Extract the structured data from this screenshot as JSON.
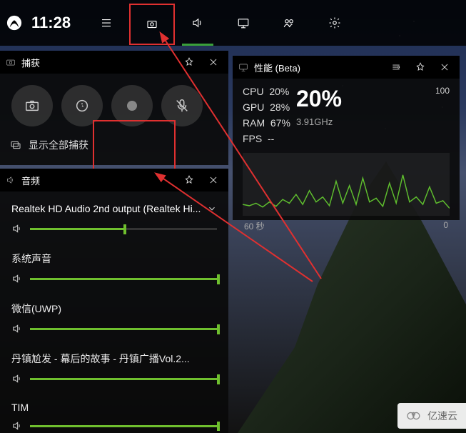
{
  "topbar": {
    "time": "11:28"
  },
  "capture": {
    "title": "捕获",
    "show_all": "显示全部捕获"
  },
  "audio": {
    "title": "音频",
    "device": "Realtek HD Audio 2nd output (Realtek Hi...",
    "device_vol": 50,
    "sections": [
      {
        "name": "系统声音",
        "vol": 100
      },
      {
        "name": "微信(UWP)",
        "vol": 100
      },
      {
        "name": "丹镇尬发 - 幕后的故事 - 丹镇广播Vol.2...",
        "vol": 100
      },
      {
        "name": "TIM",
        "vol": 100
      }
    ]
  },
  "perf": {
    "title": "性能 (Beta)",
    "metrics": {
      "cpu_label": "CPU",
      "cpu": "20%",
      "gpu_label": "GPU",
      "gpu": "28%",
      "ram_label": "RAM",
      "ram": "67%",
      "fps_label": "FPS",
      "fps": "--"
    },
    "big": "20%",
    "freq": "3.91GHz",
    "ymax": "100",
    "xlabel": "60 秒",
    "ymin": "0"
  },
  "chart_data": {
    "type": "line",
    "title": "CPU",
    "ylabel": "%",
    "ylim": [
      0,
      100
    ],
    "xlabel": "60 秒",
    "values": [
      18,
      16,
      20,
      14,
      22,
      15,
      26,
      20,
      34,
      18,
      40,
      22,
      30,
      16,
      55,
      20,
      48,
      18,
      60,
      22,
      28,
      15,
      52,
      20,
      65,
      22,
      30,
      18,
      46,
      20,
      24,
      12
    ]
  },
  "watermark": "亿速云"
}
